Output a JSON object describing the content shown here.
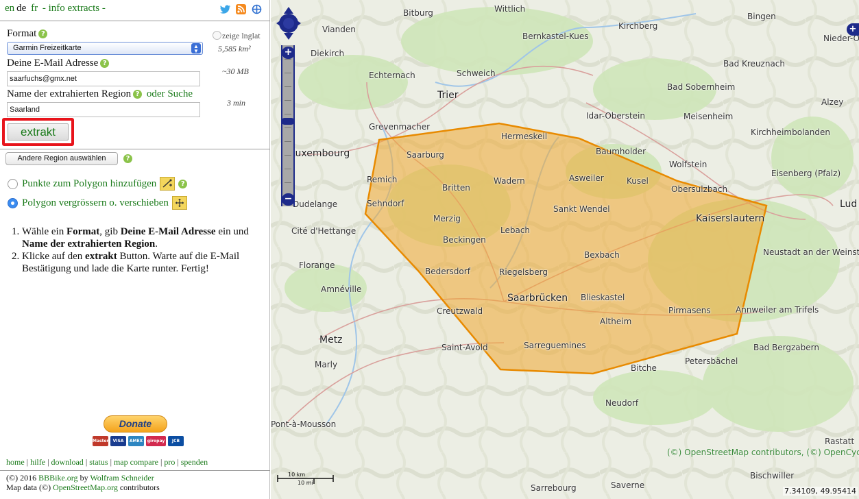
{
  "header": {
    "lang_en": "en",
    "lang_de": "de",
    "lang_fr": "fr",
    "info_link": "- info extracts -"
  },
  "form": {
    "format_label": "Format",
    "format_value": "Garmin Freizeitkarte",
    "email_label": "Deine E-Mail Adresse",
    "email_value": "saarfuchs@gmx.net",
    "region_label": "Name der extrahierten Region",
    "or_search": "oder Suche",
    "region_value": "Saarland",
    "extrakt_button": "extrakt",
    "show_lnglat": "zeige lnglat",
    "area": "5,585 km²",
    "size": "~30 MB",
    "time": "3 min"
  },
  "other_region_button": "Andere Region auswählen",
  "polygon": {
    "add_points": "Punkte zum Polygon hinzufügen",
    "move_polygon": "Polygon vergrössern o. verschieben"
  },
  "instructions": {
    "step1_a": "Wähle ein ",
    "step1_b": "Format",
    "step1_c": ", gib ",
    "step1_d": "Deine E-Mail Adresse",
    "step1_e": " ein und ",
    "step1_f": "Name der extrahierten Region",
    "step1_g": ".",
    "step2_a": "Klicke auf den ",
    "step2_b": "extrakt",
    "step2_c": " Button. Warte auf die E-Mail Bestätigung und lade die Karte runter. Fertig!"
  },
  "donate_label": "Donate",
  "payment_cards": [
    "MasterCard",
    "VISA",
    "AMEX",
    "giropay",
    "JCB"
  ],
  "footer_links": [
    "home",
    "hilfe",
    "download",
    "status",
    "map compare",
    "pro",
    "spenden"
  ],
  "credits": {
    "line1_a": "(©) 2016 ",
    "site": "BBBike.org",
    "by": " by ",
    "author": "Wolfram Schneider",
    "line2_a": "Map data (©) ",
    "osm": "OpenStreetMap.org",
    "line2_b": " contributors"
  },
  "map": {
    "cities": [
      {
        "name": "Bitburg",
        "big": false
      },
      {
        "name": "Wittlich",
        "big": false
      },
      {
        "name": "Vianden",
        "big": false
      },
      {
        "name": "Bernkastel-Kues",
        "big": false
      },
      {
        "name": "Kirchberg",
        "big": false
      },
      {
        "name": "Bingen",
        "big": false
      },
      {
        "name": "Nieder-Olm",
        "big": false
      },
      {
        "name": "Diekirch",
        "big": false
      },
      {
        "name": "Echternach",
        "big": false
      },
      {
        "name": "Schweich",
        "big": false
      },
      {
        "name": "Bad Kreuznach",
        "big": false
      },
      {
        "name": "Trier",
        "big": true
      },
      {
        "name": "Bad Sobernheim",
        "big": false
      },
      {
        "name": "Alzey",
        "big": false
      },
      {
        "name": "Idar-Oberstein",
        "big": false
      },
      {
        "name": "Meisenheim",
        "big": false
      },
      {
        "name": "Grevenmacher",
        "big": false
      },
      {
        "name": "Kirchheimbolanden",
        "big": false
      },
      {
        "name": "Hermeskeil",
        "big": false
      },
      {
        "name": "Baumholder",
        "big": false
      },
      {
        "name": "Luxembourg",
        "big": true
      },
      {
        "name": "Saarburg",
        "big": false
      },
      {
        "name": "Wolfstein",
        "big": false
      },
      {
        "name": "Eisenberg (Pfalz)",
        "big": false
      },
      {
        "name": "Remich",
        "big": false
      },
      {
        "name": "Wadern",
        "big": false
      },
      {
        "name": "Asweiler",
        "big": false
      },
      {
        "name": "Kusel",
        "big": false
      },
      {
        "name": "Britten",
        "big": false
      },
      {
        "name": "Obersulzbach",
        "big": false
      },
      {
        "name": "Sehndorf",
        "big": false
      },
      {
        "name": "Dudelange",
        "big": false
      },
      {
        "name": "Sankt Wendel",
        "big": false
      },
      {
        "name": "Lud",
        "big": true
      },
      {
        "name": "Merzig",
        "big": false
      },
      {
        "name": "Kaiserslautern",
        "big": true
      },
      {
        "name": "Cité d'Hettange",
        "big": false
      },
      {
        "name": "Lebach",
        "big": false
      },
      {
        "name": "Beckingen",
        "big": false
      },
      {
        "name": "Neustadt an der Weinst",
        "big": false
      },
      {
        "name": "Bexbach",
        "big": false
      },
      {
        "name": "Florange",
        "big": false
      },
      {
        "name": "Bedersdorf",
        "big": false
      },
      {
        "name": "Riegelsberg",
        "big": false
      },
      {
        "name": "Amnéville",
        "big": false
      },
      {
        "name": "Saarbrücken",
        "big": true
      },
      {
        "name": "Blieskastel",
        "big": false
      },
      {
        "name": "Creutzwald",
        "big": false
      },
      {
        "name": "Pirmasens",
        "big": false
      },
      {
        "name": "Annweiler am Trifels",
        "big": false
      },
      {
        "name": "Altheim",
        "big": false
      },
      {
        "name": "Metz",
        "big": true
      },
      {
        "name": "Marly",
        "big": false
      },
      {
        "name": "Saint-Avold",
        "big": false
      },
      {
        "name": "Sarreguemines",
        "big": false
      },
      {
        "name": "Bad Bergzabern",
        "big": false
      },
      {
        "name": "Petersbächel",
        "big": false
      },
      {
        "name": "Bitche",
        "big": false
      },
      {
        "name": "Neudorf",
        "big": false
      },
      {
        "name": "Pont-à-Mousson",
        "big": false
      },
      {
        "name": "Rastatt",
        "big": false
      },
      {
        "name": "Bischwiller",
        "big": false
      },
      {
        "name": "Sarrebourg",
        "big": false
      },
      {
        "name": "Saverne",
        "big": false
      }
    ],
    "attribution": "(©) OpenStreetMap contributors, (©) OpenCycleMap",
    "scale_km": "10 km",
    "scale_mi": "10 mi",
    "coords": "7.34109, 49.95414",
    "zoom_in": "+",
    "zoom_out": "−",
    "layer_switch": "+"
  },
  "colors": {
    "link_green": "#1a7a1a",
    "highlight_red": "#e8141b",
    "polygon_fill": "#f0a830",
    "polygon_stroke": "#e88a00",
    "nav_blue": "#1d2a8a"
  }
}
